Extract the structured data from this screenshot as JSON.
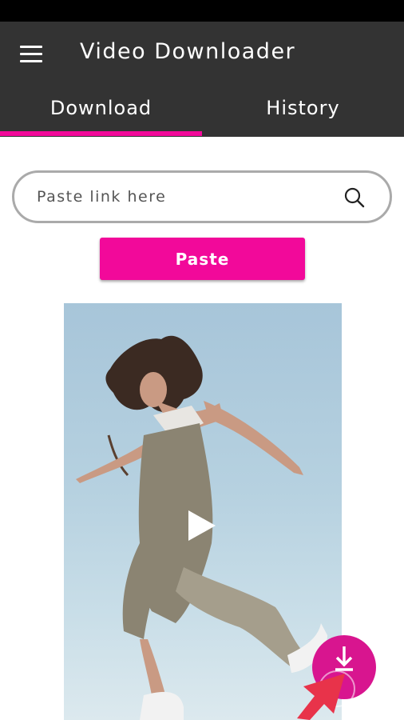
{
  "app": {
    "title": "Video Downloader"
  },
  "tabs": [
    {
      "label": "Download",
      "active": true
    },
    {
      "label": "History",
      "active": false
    }
  ],
  "search": {
    "placeholder": "Paste link here",
    "value": ""
  },
  "actions": {
    "paste_label": "Paste"
  },
  "icons": {
    "menu": "menu-icon",
    "search": "search-icon",
    "play": "play-icon",
    "download": "download-icon",
    "pointer": "pointer-arrow-icon"
  },
  "colors": {
    "accent": "#f2099a",
    "app_bar": "#333333",
    "status_bar": "#000000",
    "fab": "#d8158f",
    "pointer": "#e8334a"
  }
}
